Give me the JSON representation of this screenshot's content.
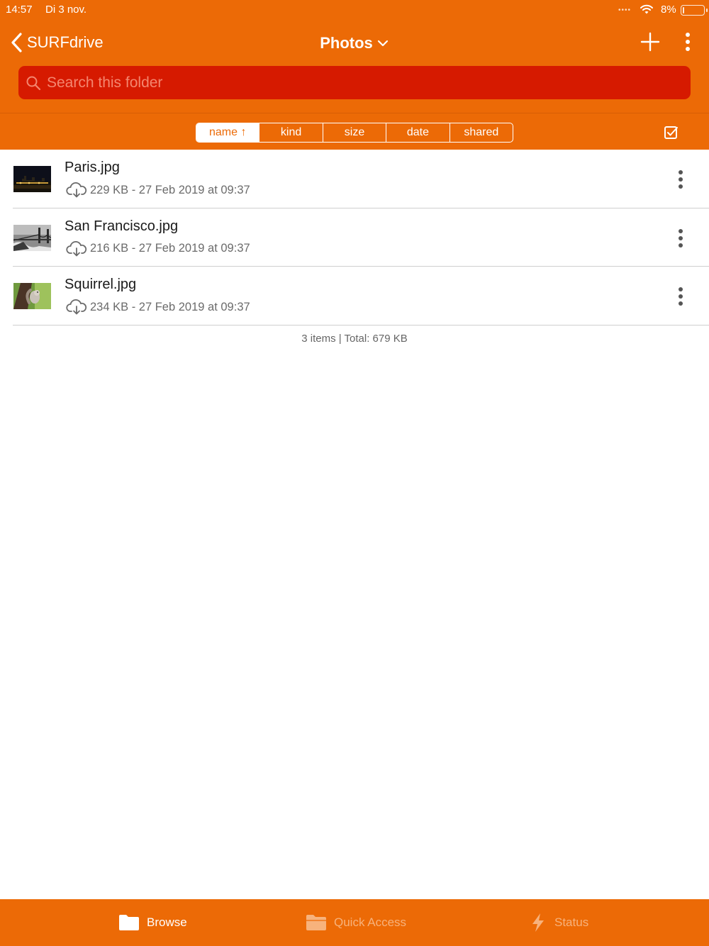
{
  "status_bar": {
    "time": "14:57",
    "date": "Di 3 nov.",
    "signal": "••••",
    "battery_percent": "8%",
    "battery_level": 0.08
  },
  "nav": {
    "back_label": "SURFdrive",
    "title": "Photos"
  },
  "search": {
    "placeholder": "Search this folder"
  },
  "sort": {
    "options": [
      {
        "label": "name ↑",
        "active": true
      },
      {
        "label": "kind",
        "active": false
      },
      {
        "label": "size",
        "active": false
      },
      {
        "label": "date",
        "active": false
      },
      {
        "label": "shared",
        "active": false
      }
    ]
  },
  "files": [
    {
      "name": "Paris.jpg",
      "meta": "229 KB - 27 Feb 2019 at 09:37",
      "thumb": "night-city"
    },
    {
      "name": "San Francisco.jpg",
      "meta": "216 KB - 27 Feb 2019 at 09:37",
      "thumb": "bridge-bw"
    },
    {
      "name": "Squirrel.jpg",
      "meta": "234 KB - 27 Feb 2019 at 09:37",
      "thumb": "squirrel"
    }
  ],
  "summary": "3 items | Total: 679 KB",
  "tabs": [
    {
      "label": "Browse",
      "icon": "folder-icon",
      "active": true
    },
    {
      "label": "Quick Access",
      "icon": "folder-open-icon",
      "active": false
    },
    {
      "label": "Status",
      "icon": "lightning-icon",
      "active": false
    }
  ],
  "colors": {
    "brand": "#EC6A06",
    "search_bg": "#D61A00",
    "tab_inactive": "#F7B27C"
  }
}
